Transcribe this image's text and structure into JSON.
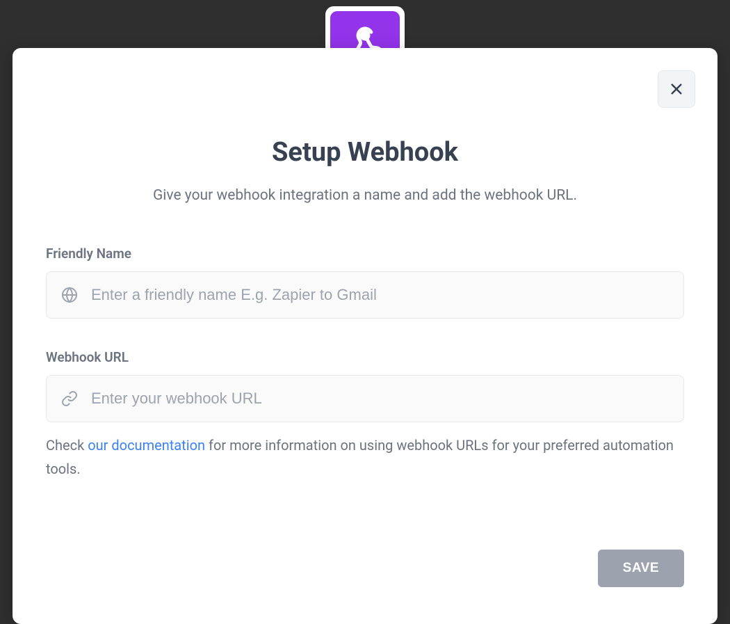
{
  "modal": {
    "title": "Setup Webhook",
    "subtitle": "Give your webhook integration a name and add the webhook URL.",
    "close_label": "Close"
  },
  "fields": {
    "friendly_name": {
      "label": "Friendly Name",
      "placeholder": "Enter a friendly name E.g. Zapier to Gmail",
      "value": ""
    },
    "webhook_url": {
      "label": "Webhook URL",
      "placeholder": "Enter your webhook URL",
      "value": ""
    }
  },
  "helper": {
    "prefix": "Check ",
    "link_text": "our documentation",
    "suffix": " for more information on using webhook URLs for your preferred automation tools."
  },
  "actions": {
    "save_label": "SAVE"
  }
}
